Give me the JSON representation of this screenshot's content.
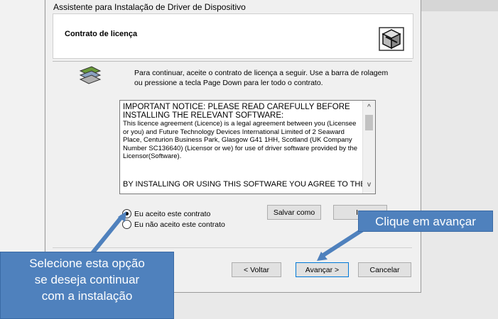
{
  "window": {
    "title": "Assistente para Instalação de Driver de Dispositivo"
  },
  "header": {
    "title": "Contrato de licença"
  },
  "instruction": "Para continuar, aceite o contrato de licença a seguir. Use a barra de rolagem ou pressione a tecla Page Down para ler todo o contrato.",
  "license": {
    "heading": "IMPORTANT NOTICE: PLEASE READ CAREFULLY BEFORE INSTALLING THE RELEVANT SOFTWARE:",
    "body": "This licence agreement (Licence) is a legal agreement between you (Licensee or you) and Future Technology Devices International Limited of 2 Seaward Place, Centurion Business Park, Glasgow G41 1HH, Scotland (UK Company Number SC136640) (Licensor or we) for use of driver software provided by the Licensor(Software).",
    "bottom": "BY INSTALLING OR USING THIS SOFTWARE YOU AGREE TO THE"
  },
  "radios": {
    "accept": "Eu aceito este contrato",
    "decline": "Eu não aceito este contrato",
    "selected": "accept"
  },
  "buttons": {
    "save_as": "Salvar como",
    "print": "Im",
    "back": "< Voltar",
    "next": "Avançar >",
    "cancel": "Cancelar"
  },
  "callouts": {
    "next": "Clique em avançar",
    "select_line1": "Selecione esta opção",
    "select_line2": "se deseja continuar",
    "select_line3": "com a instalação"
  },
  "colors": {
    "callout": "#4f81bd",
    "default_button_border": "#0078d7"
  }
}
